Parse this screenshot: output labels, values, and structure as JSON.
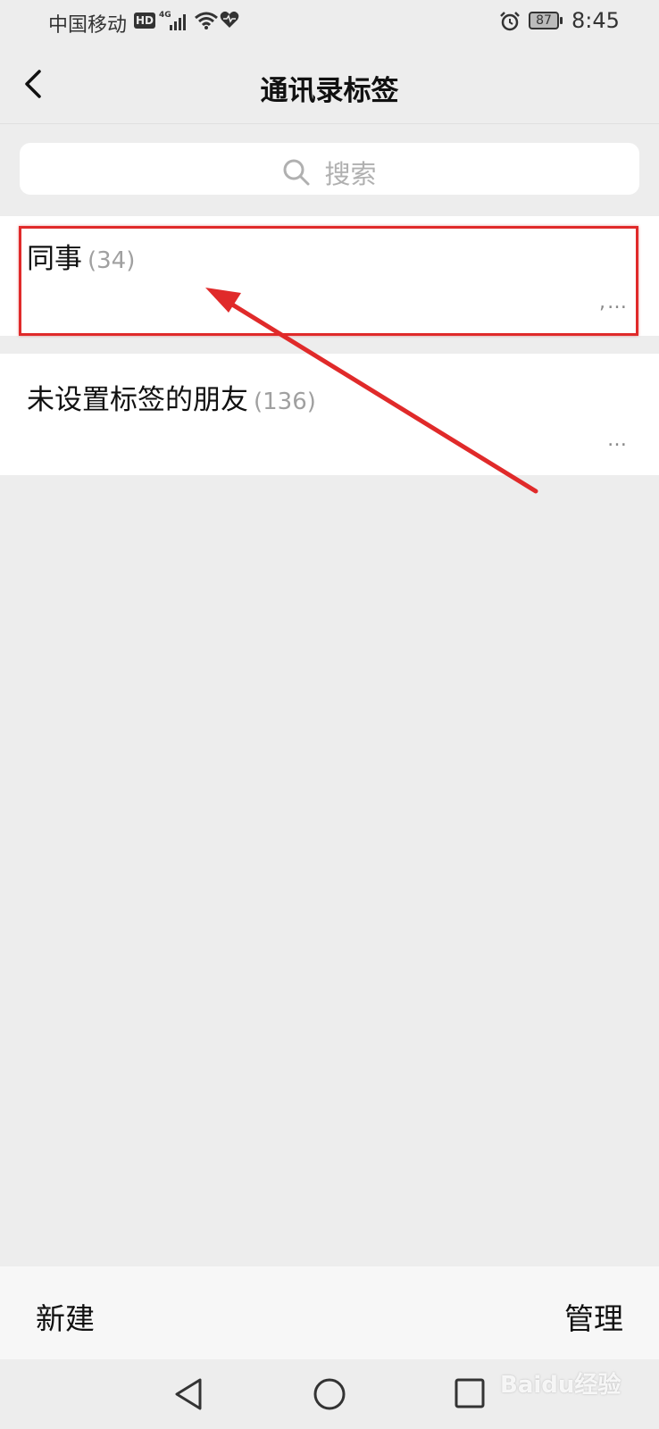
{
  "status_bar": {
    "carrier": "中国移动",
    "hd": "HD",
    "network": "4G",
    "battery": "87",
    "time": "8:45"
  },
  "nav": {
    "title": "通讯录标签"
  },
  "search": {
    "placeholder": "搜索"
  },
  "tags": [
    {
      "name": "同事",
      "count": "(34)",
      "members": ",…"
    },
    {
      "name": "未设置标签的朋友",
      "count": "(136)",
      "members": "…"
    }
  ],
  "bottom_bar": {
    "new_label": "新建",
    "manage_label": "管理"
  },
  "annotation": {
    "color": "#e02a2a"
  },
  "watermark": "Baidu经验"
}
